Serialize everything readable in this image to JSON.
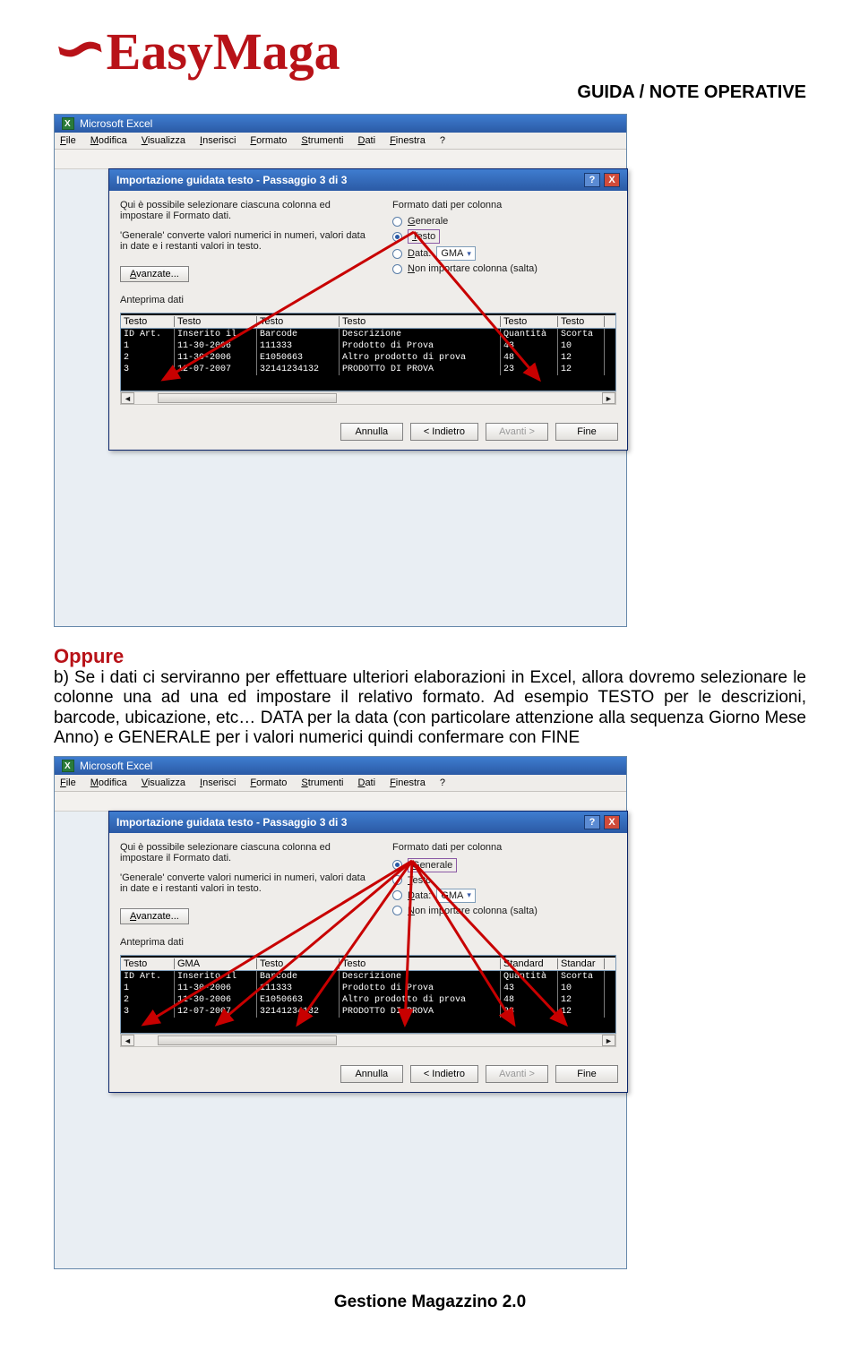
{
  "header": {
    "logo_text": "EasyMaga",
    "right_title": "GUIDA / NOTE OPERATIVE"
  },
  "shared_ui": {
    "excel_title": "Microsoft Excel",
    "menus": [
      "File",
      "Modifica",
      "Visualizza",
      "Inserisci",
      "Formato",
      "Strumenti",
      "Dati",
      "Finestra",
      "?"
    ],
    "wizard_title": "Importazione guidata testo - Passaggio 3 di 3",
    "instr1": "Qui è possibile selezionare ciascuna colonna ed impostare il Formato dati.",
    "instr2": "'Generale' converte valori numerici in numeri, valori data in date e i restanti valori in testo.",
    "group_label": "Formato dati per colonna",
    "opt_generale": "Generale",
    "opt_testo": "Testo",
    "opt_data": "Data:",
    "data_value": "GMA",
    "opt_skip": "Non importare colonna (salta)",
    "advanced_btn": "Avanzate...",
    "preview_label": "Anteprima dati",
    "btn_cancel": "Annulla",
    "btn_back": "< Indietro",
    "btn_next": "Avanti >",
    "btn_finish": "Fine"
  },
  "screenshot1": {
    "selected_option": "Testo",
    "column_types": [
      "Testo",
      "Testo",
      "Testo",
      "Testo",
      "Testo",
      "Testo"
    ],
    "grid": {
      "header": [
        "ID Art.",
        "Inserito il",
        "Barcode",
        "Descrizione",
        "Quantità",
        "Scorta"
      ],
      "rows": [
        [
          "1",
          "11-30-2006",
          "111333",
          "Prodotto di Prova",
          "43",
          "10"
        ],
        [
          "2",
          "11-30-2006",
          "E1050663",
          "Altro prodotto di prova",
          "48",
          "12"
        ],
        [
          "3",
          "12-07-2007",
          "32141234132",
          "PRODOTTO DI PROVA",
          "23",
          "12"
        ]
      ]
    }
  },
  "paragraph": {
    "oppure": "Oppure",
    "body": "b) Se i dati ci serviranno per effettuare ulteriori elaborazioni in Excel, allora dovremo selezionare le colonne una ad una ed impostare il relativo formato. Ad esempio TESTO per le descrizioni, barcode, ubicazione, etc… DATA per la data (con particolare attenzione alla sequenza Giorno Mese Anno) e GENERALE per i valori numerici quindi confermare con FINE"
  },
  "screenshot2": {
    "selected_option": "Generale",
    "column_types": [
      "Testo",
      "GMA",
      "Testo",
      "Testo",
      "Standard",
      "Standar"
    ],
    "grid": {
      "header": [
        "ID Art.",
        "Inserito il",
        "Barcode",
        "Descrizione",
        "Quantità",
        "Scorta"
      ],
      "rows": [
        [
          "1",
          "11-30-2006",
          "111333",
          "Prodotto di Prova",
          "43",
          "10"
        ],
        [
          "2",
          "11-30-2006",
          "E1050663",
          "Altro prodotto di prova",
          "48",
          "12"
        ],
        [
          "3",
          "12-07-2007",
          "32141234132",
          "PRODOTTO DI PROVA",
          "23",
          "12"
        ]
      ]
    }
  },
  "footer": "Gestione Magazzino  2.0"
}
